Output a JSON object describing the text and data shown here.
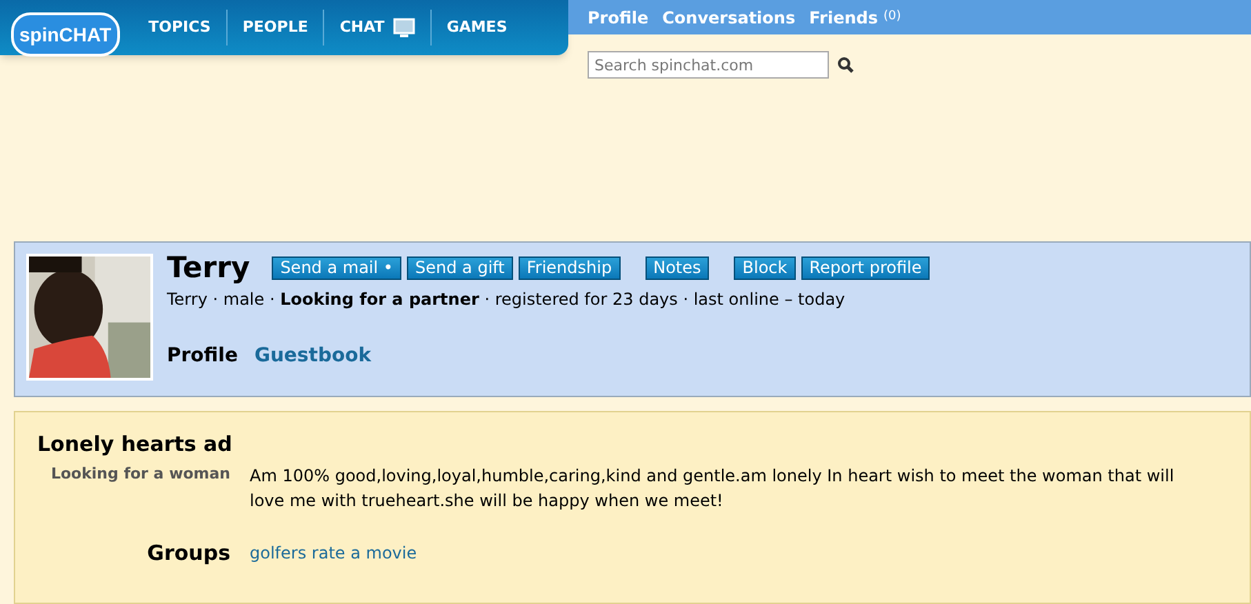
{
  "logo": "spinCHAT",
  "nav": [
    {
      "label": "TOPICS",
      "kind": "text"
    },
    {
      "label": "PEOPLE",
      "kind": "text"
    },
    {
      "label": "CHAT",
      "kind": "monitor"
    },
    {
      "label": "GAMES",
      "kind": "text"
    }
  ],
  "top_links": [
    {
      "label": "Profile"
    },
    {
      "label": "Conversations"
    },
    {
      "label": "Friends",
      "count": "(0)"
    }
  ],
  "search": {
    "placeholder": "Search spinchat.com"
  },
  "profile": {
    "name": "Terry",
    "action_groups": [
      [
        {
          "label": "Send a mail •"
        },
        {
          "label": "Send a gift"
        },
        {
          "label": "Friendship"
        }
      ],
      [
        {
          "label": "Notes"
        }
      ],
      [
        {
          "label": "Block"
        },
        {
          "label": "Report profile"
        }
      ]
    ],
    "summary": "Terry · male · **Looking for a partner** · registered for 23 days · last online – today",
    "tabs": [
      {
        "label": "Profile",
        "selected": true
      },
      {
        "label": "Guestbook",
        "selected": false
      }
    ]
  },
  "ad": {
    "title": "Lonely hearts ad",
    "looking_label": "Looking for a woman",
    "text": "Am 100% good,loving,loyal,humble,caring,kind and gentle.am lonely In heart wish to meet the woman that will love me with trueheart.she will be happy when we meet!",
    "groups_label": "Groups",
    "groups": [
      "golfers rate a movie"
    ]
  }
}
